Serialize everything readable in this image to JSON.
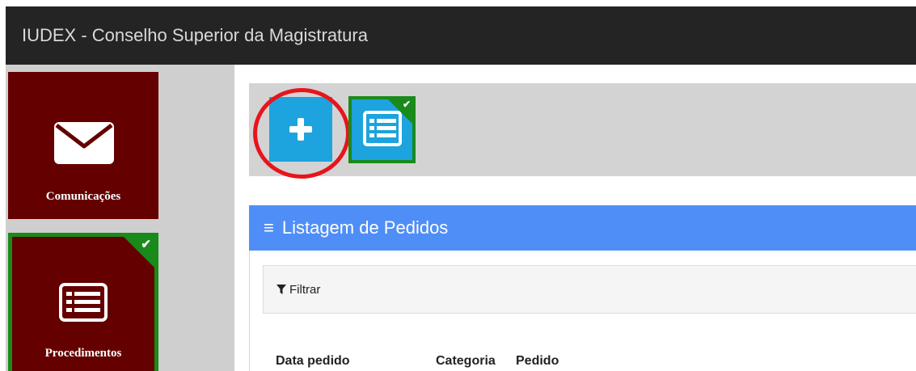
{
  "window": {
    "title": "IUDEX - Conselho Superior da Magistratura"
  },
  "sidebar": {
    "items": [
      {
        "label": "Comunicações",
        "icon": "envelope-icon",
        "color": "#640000"
      },
      {
        "label": "Procedimentos",
        "icon": "list-icon",
        "color": "#640000",
        "selected": true
      }
    ]
  },
  "toolbar": {
    "add_icon": "plus-icon",
    "list_icon": "list-icon"
  },
  "panel": {
    "title": "Listagem de Pedidos",
    "header_color": "#4f8ef7",
    "filter_label": "Filtrar",
    "columns": [
      "Data pedido",
      "Categoria",
      "Pedido"
    ]
  },
  "colors": {
    "accent_blue": "#1da3de",
    "selected_green": "#1a8a1a",
    "annotation_red": "#e8141b"
  }
}
